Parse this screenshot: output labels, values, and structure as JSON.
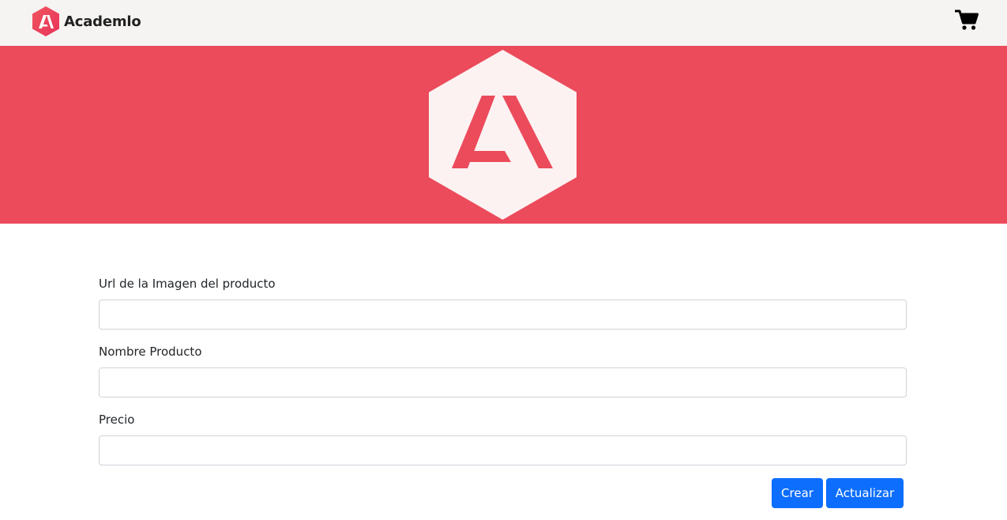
{
  "navbar": {
    "brand_name": "Academlo",
    "brand_icon": "academlo-logo-icon",
    "cart_icon": "cart-icon"
  },
  "hero": {
    "logo_icon": "academlo-hexagon-logo-icon"
  },
  "form": {
    "image_url": {
      "label": "Url de la Imagen del producto",
      "value": "",
      "placeholder": ""
    },
    "product_name": {
      "label": "Nombre Producto",
      "value": "",
      "placeholder": ""
    },
    "price": {
      "label": "Precio",
      "value": "",
      "placeholder": ""
    }
  },
  "actions": {
    "create_label": "Crear",
    "update_label": "Actualizar"
  },
  "colors": {
    "brand_red": "#eb4b5b",
    "navbar_bg": "#f5f4f2",
    "hero_logo_bg": "#fdf2f2",
    "button_primary": "#0d6efd"
  }
}
